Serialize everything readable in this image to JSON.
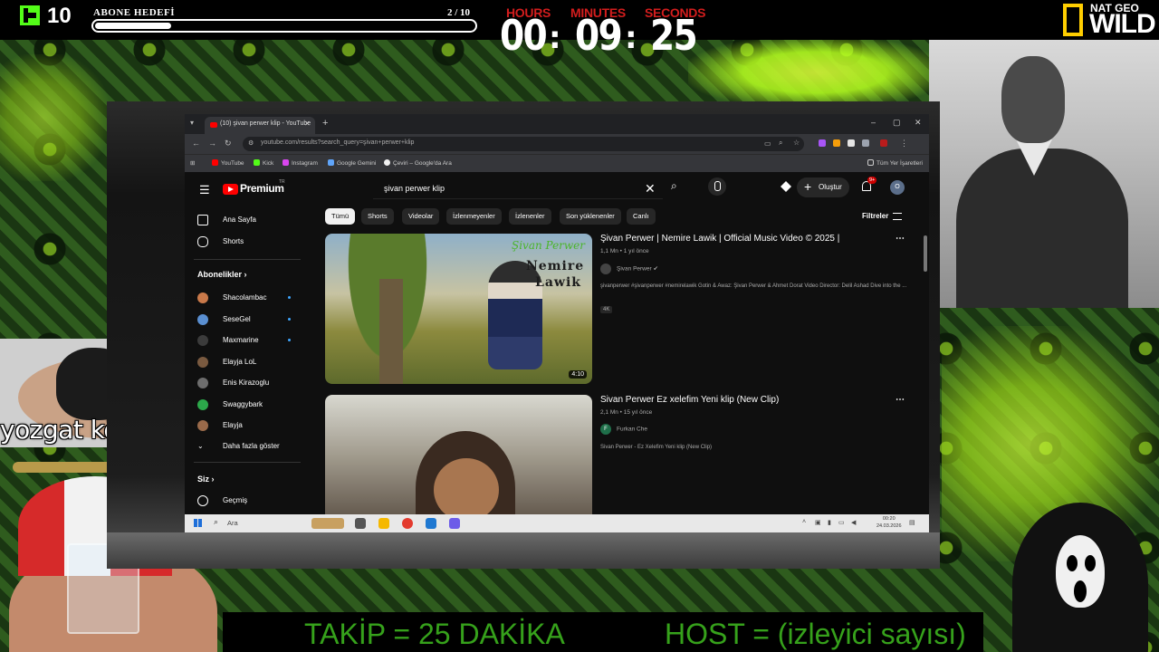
{
  "overlay": {
    "kick_count": "10",
    "goal": {
      "title": "ABONE HEDEFİ",
      "count": "2 / 10",
      "progress": 0.2
    },
    "timer": {
      "hours_label": "HOURS",
      "minutes_label": "MINUTES",
      "seconds_label": "SECONDS",
      "hours": "00",
      "minutes": "09",
      "seconds": "25",
      "separator": ":"
    },
    "natgeo": {
      "top": "NAT GEO",
      "bottom": "WILD"
    },
    "coal_caption": "yozgat kömürü",
    "ticker": {
      "left": "TAKİP = 25 DAKİKA",
      "right": "HOST = (izleyici sayısı)"
    },
    "colors": {
      "kick_green": "#53fc18",
      "timer_label_red": "#d21d1d",
      "ticker_green": "#36a11b"
    }
  },
  "browser": {
    "tab_title": "(10) şivan perwer klip - YouTube",
    "new_tab": "+",
    "window_buttons": [
      "–",
      "▢",
      "✕"
    ],
    "url": "youtube.com/results?search_query=şivan+perwer+klip",
    "bookmarks": [
      "YouTube",
      "Kick",
      "Instagram",
      "Google Gemini",
      "Çeviri – Google'da Ara"
    ],
    "all_bookmarks": "Tüm Yer İşaretleri"
  },
  "youtube": {
    "brand": "Premium",
    "brand_tm": "TR",
    "search_query": "şivan perwer  klip",
    "create_label": "Oluştur",
    "notification_badge": "9+",
    "avatar_letter": "O",
    "sidebar": {
      "nav": [
        {
          "label": "Ana Sayfa",
          "icon": "home-icon"
        },
        {
          "label": "Shorts",
          "icon": "shorts-icon"
        }
      ],
      "subscriptions_header": "Abonelikler",
      "subscriptions": [
        {
          "label": "Shacolambac",
          "color": "#c9794a"
        },
        {
          "label": "SeseGel",
          "color": "#5a8fd1"
        },
        {
          "label": "Maxmarine",
          "color": "#3b3b3b"
        },
        {
          "label": "Elayja LoL",
          "color": "#7a5a40"
        },
        {
          "label": "Enis Kirazoglu",
          "color": "#6d6d6d"
        },
        {
          "label": "Swaggybark",
          "color": "#2ca84a"
        },
        {
          "label": "Elayja",
          "color": "#9a6a4a"
        }
      ],
      "show_more": "Daha fazla göster",
      "you_header": "Siz",
      "history": "Geçmiş"
    },
    "chips": [
      "Tümü",
      "Shorts",
      "Videolar",
      "İzlenmeyenler",
      "İzlenenler",
      "Son yüklenenler",
      "Canlı"
    ],
    "filters": "Filtreler",
    "videos": [
      {
        "title": "Şivan Perwer | Nemire Lawik | Official Music Video © 2025 |",
        "meta": "1,1 Mn • 1 yıl önce",
        "channel": "Şivan Perwer",
        "verified": "✔",
        "description": "şivanperwer #şivanperwer #nemirelawik Gotin & Awaz: Şivan Perwer & Ahmet Dorat Video Director: Delil Ashad Dive into the ...",
        "badge": "4K",
        "thumb_script": "Şivan Perwer",
        "thumb_title_1": "Nemire",
        "thumb_title_2": "Lawik",
        "duration": "4:10"
      },
      {
        "title": "Sivan Perwer Ez xelefim Yeni klip (New Clip)",
        "meta": "2,1 Mn • 15 yıl önce",
        "channel": "Furkan Che",
        "channel_letter": "F",
        "description": "Sivan Perwer - Ez Xelefim Yeni klip (New Clip)"
      }
    ]
  },
  "taskbar": {
    "search": "Ara",
    "time": "00:20",
    "date": "24.03.2026"
  }
}
